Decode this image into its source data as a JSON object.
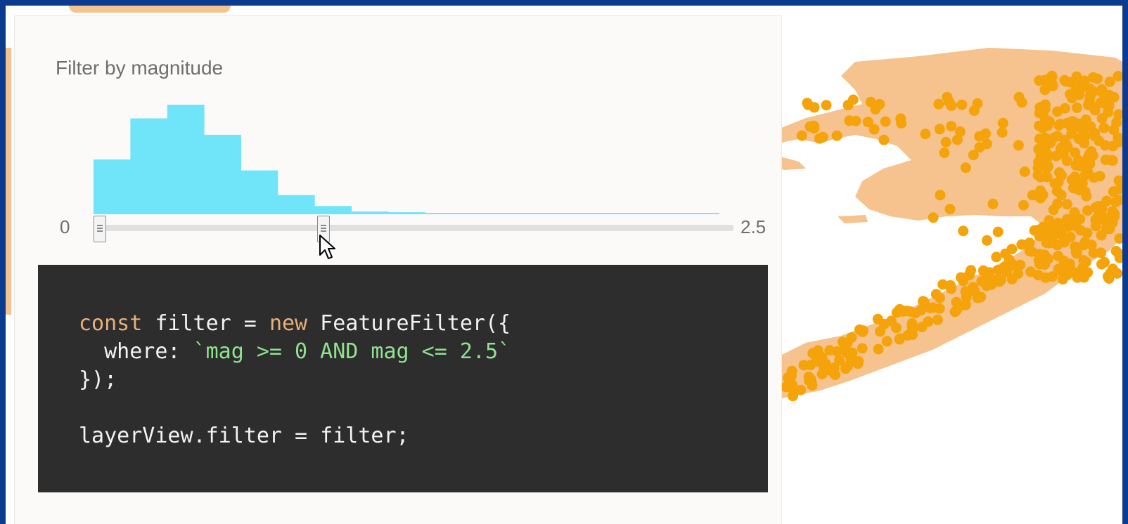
{
  "filter_panel": {
    "title": "Filter by magnitude",
    "slider": {
      "min_label": "0",
      "max_label": "2.5",
      "range_min": 0,
      "range_max": 2.5
    },
    "histogram_fill_color": "#70e5f9",
    "histogram_counts": [
      40,
      70,
      80,
      58,
      32,
      14,
      6,
      2,
      1.5,
      1,
      1,
      1,
      1,
      1,
      1,
      1,
      1
    ]
  },
  "code_block": {
    "line1": {
      "keyword_const": "const",
      "text1": " filter = ",
      "keyword_new": "new",
      "text2": " FeatureFilter({"
    },
    "line2": {
      "prop": "  where: ",
      "string": "`mag >= 0 AND mag <= 2.5`"
    },
    "line3": "});",
    "line4": "",
    "line5": "layerView.filter = filter;",
    "background_color": "#2d2d2d",
    "keyword_color": "#e8b07a",
    "string_color": "#8fe38f"
  },
  "map": {
    "land_color": "#f6c28e",
    "point_color": "#f5a30a"
  },
  "frame_color": "#0b3a8e"
}
